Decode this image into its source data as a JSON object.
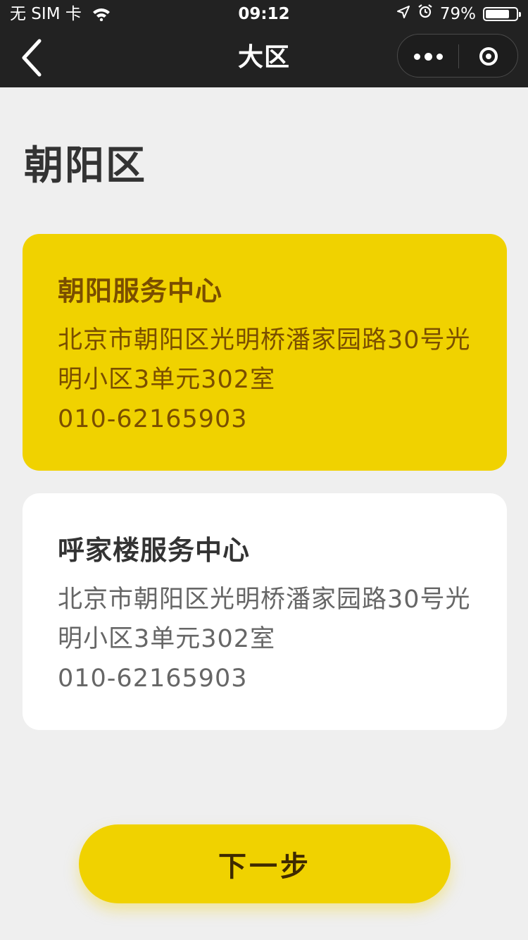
{
  "status_bar": {
    "carrier": "无 SIM 卡",
    "time": "09:12",
    "battery_percent": "79%",
    "battery_level": 0.79,
    "icons": [
      "wifi-icon",
      "location-arrow-icon",
      "alarm-clock-icon",
      "battery-icon"
    ]
  },
  "nav": {
    "title": "大区",
    "back_icon": "chevron-left-icon",
    "more_icon": "more-dots-icon",
    "close_icon": "target-circle-icon"
  },
  "district": "朝阳区",
  "centers": [
    {
      "name": "朝阳服务中心",
      "address": "北京市朝阳区光明桥潘家园路30号光明小区3单元302室",
      "phone": "010-62165903",
      "selected": true
    },
    {
      "name": "呼家楼服务中心",
      "address": "北京市朝阳区光明桥潘家园路30号光明小区3单元302室",
      "phone": "010-62165903",
      "selected": false
    }
  ],
  "next_button": "下一步",
  "colors": {
    "header_bg": "#222222",
    "accent": "#f0d200",
    "selected_text": "#7a4e00",
    "page_bg": "#efefef"
  }
}
